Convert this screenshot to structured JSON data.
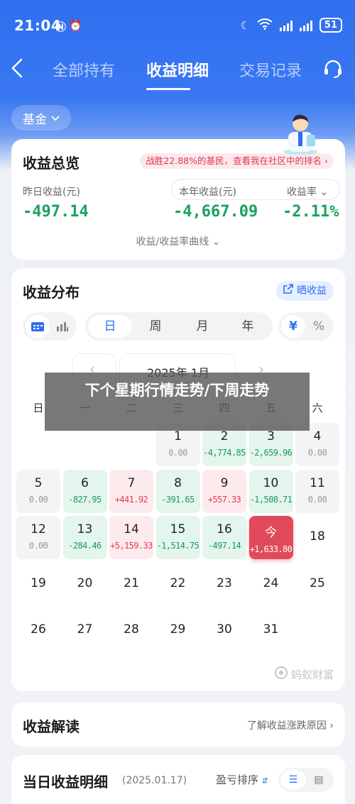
{
  "status_bar": {
    "time": "21:04",
    "icons": [
      "nfc-icon",
      "alarm-icon"
    ],
    "battery": "51"
  },
  "nav": {
    "tabs": [
      {
        "label": "全部持有",
        "active": false
      },
      {
        "label": "收益明细",
        "active": true
      },
      {
        "label": "交易记录",
        "active": false
      }
    ]
  },
  "fund_selector": {
    "label": "基金"
  },
  "overview": {
    "title": "收益总览",
    "promo": "战胜22.88%的基民，查看我在社区中的排名",
    "stats": [
      {
        "label": "昨日收益(元)",
        "value": "-497.14"
      },
      {
        "label": "本年收益(元)",
        "value": "-4,667.09"
      },
      {
        "label": "收益率",
        "value": "-2.11%"
      }
    ],
    "curve_link": "收益/收益率曲线"
  },
  "distribution": {
    "title": "收益分布",
    "share_button": "晒收益",
    "periods": [
      "日",
      "周",
      "月",
      "年"
    ],
    "active_period": "日",
    "units": [
      "¥",
      "%"
    ],
    "active_unit": "¥",
    "month": "2025年 1月",
    "weekdays": [
      "日",
      "一",
      "二",
      "三",
      "四",
      "五",
      "六"
    ],
    "days": [
      {
        "day": "1",
        "value": "0.00",
        "kind": "zero"
      },
      {
        "day": "2",
        "value": "-4,774.85",
        "kind": "loss"
      },
      {
        "day": "3",
        "value": "-2,659.96",
        "kind": "loss"
      },
      {
        "day": "4",
        "value": "0.00",
        "kind": "zero"
      },
      {
        "day": "5",
        "value": "0.00",
        "kind": "zero"
      },
      {
        "day": "6",
        "value": "-827.95",
        "kind": "loss"
      },
      {
        "day": "7",
        "value": "+441.92",
        "kind": "gain"
      },
      {
        "day": "8",
        "value": "-391.65",
        "kind": "loss"
      },
      {
        "day": "9",
        "value": "+557.33",
        "kind": "gain"
      },
      {
        "day": "10",
        "value": "-1,508.71",
        "kind": "loss"
      },
      {
        "day": "11",
        "value": "0.00",
        "kind": "zero"
      },
      {
        "day": "12",
        "value": "0.00",
        "kind": "zero"
      },
      {
        "day": "13",
        "value": "-284.46",
        "kind": "loss"
      },
      {
        "day": "14",
        "value": "+5,159.33",
        "kind": "gain"
      },
      {
        "day": "15",
        "value": "-1,514.75",
        "kind": "loss"
      },
      {
        "day": "16",
        "value": "-497.14",
        "kind": "loss"
      },
      {
        "day": "今",
        "value": "+1,633.80",
        "kind": "today"
      },
      {
        "day": "18",
        "value": "",
        "kind": "plain"
      },
      {
        "day": "19",
        "value": "",
        "kind": "plain"
      },
      {
        "day": "20",
        "value": "",
        "kind": "plain"
      },
      {
        "day": "21",
        "value": "",
        "kind": "plain"
      },
      {
        "day": "22",
        "value": "",
        "kind": "plain"
      },
      {
        "day": "23",
        "value": "",
        "kind": "plain"
      },
      {
        "day": "24",
        "value": "",
        "kind": "plain"
      },
      {
        "day": "25",
        "value": "",
        "kind": "plain"
      },
      {
        "day": "26",
        "value": "",
        "kind": "plain"
      },
      {
        "day": "27",
        "value": "",
        "kind": "plain"
      },
      {
        "day": "28",
        "value": "",
        "kind": "plain"
      },
      {
        "day": "29",
        "value": "",
        "kind": "plain"
      },
      {
        "day": "30",
        "value": "",
        "kind": "plain"
      },
      {
        "day": "31",
        "value": "",
        "kind": "plain"
      }
    ],
    "watermark": "蚂蚁财富"
  },
  "overlay_caption": "下个星期行情走势/下周走势",
  "interpretation": {
    "title": "收益解读",
    "link": "了解收益涨跌原因"
  },
  "detail": {
    "title": "当日收益明细",
    "date": "(2025.01.17)",
    "sort_label": "盈亏排序"
  }
}
